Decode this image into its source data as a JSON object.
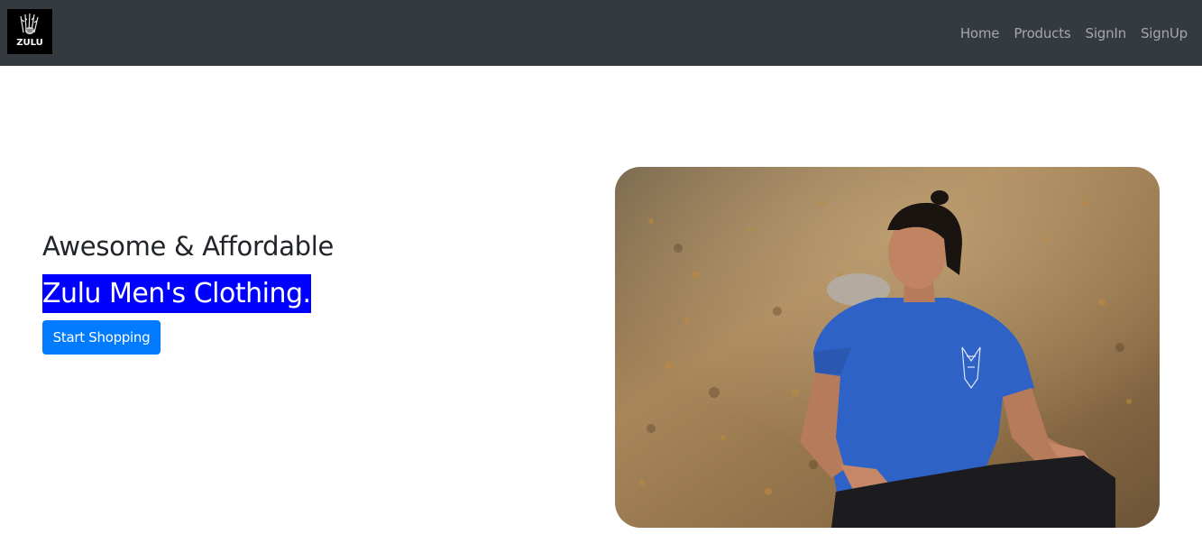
{
  "navbar": {
    "logo_text": "ZULU",
    "links": [
      {
        "label": "Home"
      },
      {
        "label": "Products"
      },
      {
        "label": "SignIn"
      },
      {
        "label": "SignUp"
      }
    ],
    "colors": {
      "background": "#343a40",
      "link": "#adb5bd"
    }
  },
  "hero": {
    "heading": "Awesome & Affordable",
    "subheading": "Zulu Men's Clothing.",
    "cta_label": "Start Shopping",
    "colors": {
      "highlight": "#0000ff",
      "button": "#007bff"
    },
    "image_icon": "man-in-blue-tshirt-photo"
  }
}
